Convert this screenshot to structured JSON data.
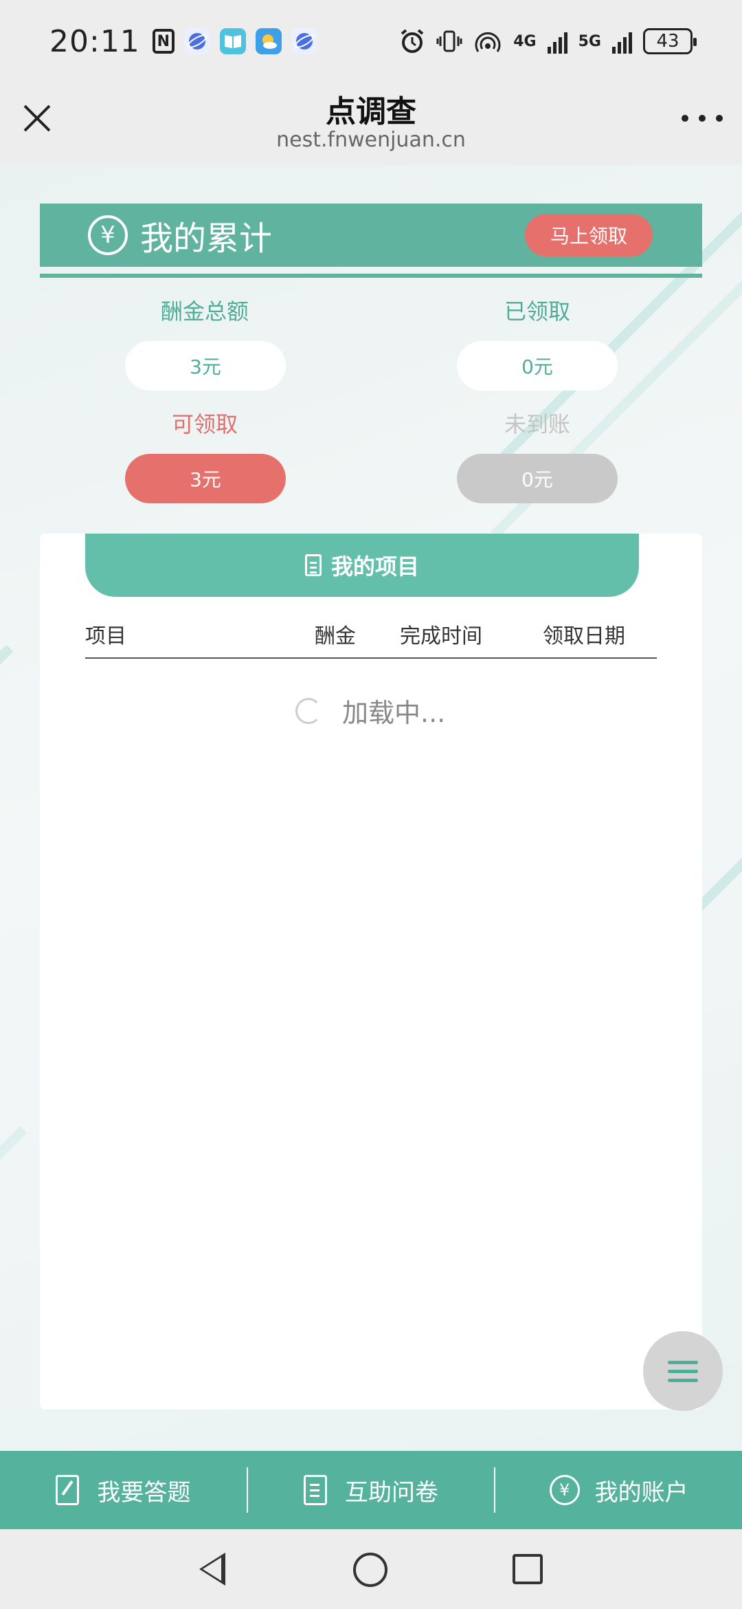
{
  "status_bar": {
    "time": "20:11",
    "network_1": "4G",
    "network_2": "5G",
    "battery": "43"
  },
  "title_bar": {
    "title": "点调查",
    "url": "nest.fnwenjuan.cn"
  },
  "summary": {
    "title": "我的累计",
    "claim_button": "马上领取",
    "total_label": "酬金总额",
    "total_value": "3元",
    "claimed_label": "已领取",
    "claimed_value": "0元",
    "claimable_label": "可领取",
    "claimable_value": "3元",
    "pending_label": "未到账",
    "pending_value": "0元"
  },
  "projects": {
    "title": "我的项目",
    "columns": [
      "项目",
      "酬金",
      "完成时间",
      "领取日期"
    ],
    "loading_text": "加载中..."
  },
  "bottom_nav": {
    "items": [
      {
        "label": "我要答题",
        "icon": "edit-icon"
      },
      {
        "label": "互助问卷",
        "icon": "document-icon"
      },
      {
        "label": "我的账户",
        "icon": "yen-icon"
      }
    ]
  },
  "colors": {
    "primary": "#5fb39f",
    "accent_red": "#e6706c",
    "pending_gray": "#c9c9c9"
  }
}
